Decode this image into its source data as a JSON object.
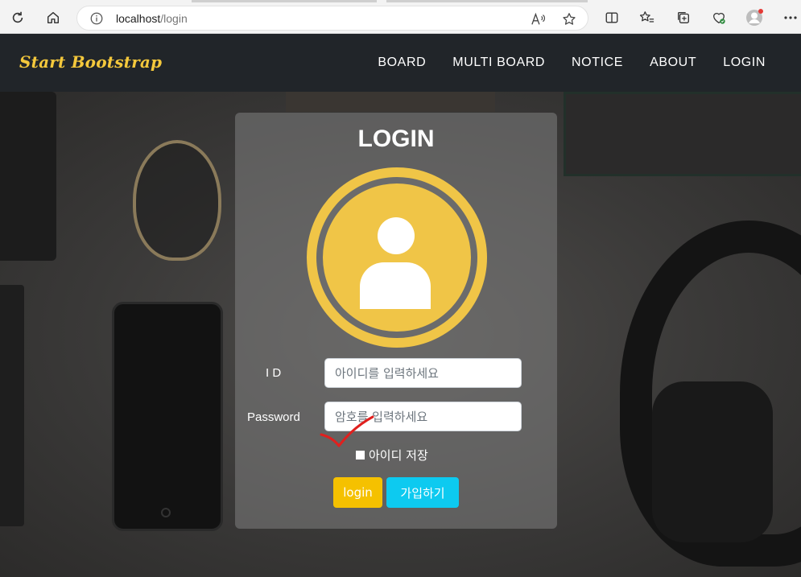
{
  "browser": {
    "url_host": "localhost",
    "url_path": "/login",
    "read_aloud_icon": "Aᴬ"
  },
  "navbar": {
    "brand": "Start Bootstrap",
    "links": [
      "BOARD",
      "MULTI BOARD",
      "NOTICE",
      "ABOUT",
      "LOGIN"
    ]
  },
  "login": {
    "title": "LOGIN",
    "id_label": "I D",
    "id_placeholder": "아이디를 입력하세요",
    "password_label": "Password",
    "password_placeholder": "암호를 입력하세요",
    "remember_label": "아이디 저장",
    "login_button": "login",
    "join_button": "가입하기"
  },
  "colors": {
    "navbar_bg": "#212529",
    "brand": "#f4c83c",
    "avatar": "#f0c547",
    "login_button": "#f5c100",
    "join_button": "#0dcaf0",
    "annotation": "#e0201e"
  }
}
